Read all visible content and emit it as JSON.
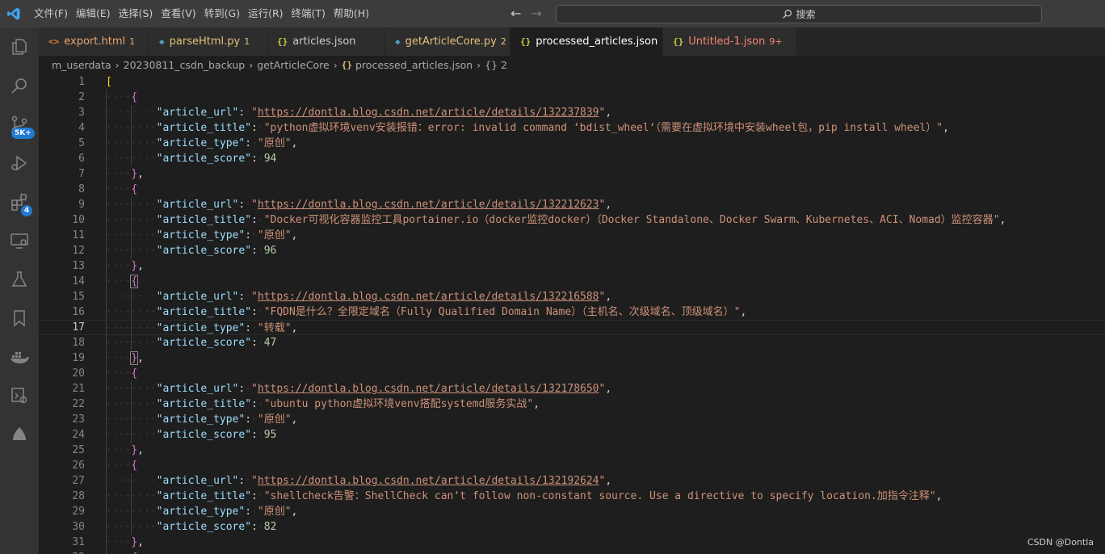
{
  "titlebar": {
    "menus": [
      "文件(F)",
      "编辑(E)",
      "选择(S)",
      "查看(V)",
      "转到(G)",
      "运行(R)",
      "终端(T)",
      "帮助(H)"
    ],
    "search_placeholder": "搜索"
  },
  "activitybar": {
    "scm_badge": "5K+",
    "extensions_badge": "4"
  },
  "tabs": [
    {
      "icon": "<>",
      "label": "export.html",
      "badge": "1",
      "color": "#e8a56b",
      "icon_color": "#e37933"
    },
    {
      "icon": "py",
      "label": "parseHtml.py",
      "badge": "1",
      "color": "#e5c07b",
      "icon_color": "#519aba"
    },
    {
      "icon": "{}",
      "label": "articles.json",
      "badge": "",
      "color": "#cccccc",
      "icon_color": "#cbcb41"
    },
    {
      "icon": "py",
      "label": "getArticleCore.py",
      "badge": "2",
      "color": "#e5c07b",
      "icon_color": "#519aba"
    },
    {
      "icon": "{}",
      "label": "processed_articles.json",
      "badge": "",
      "color": "#ffffff",
      "icon_color": "#cbcb41",
      "active": true
    },
    {
      "icon": "{}",
      "label": "Untitled-1.json",
      "badge": "9+",
      "color": "#f48771",
      "icon_color": "#cbcb41"
    }
  ],
  "breadcrumb": {
    "parts": [
      "m_userdata",
      "20230811_csdn_backup",
      "getArticleCore"
    ],
    "file_icon": "{}",
    "file": "processed_articles.json",
    "symbol": "{} 2"
  },
  "articles": [
    {
      "url": "https://dontla.blog.csdn.net/article/details/132237839",
      "title": "python虚拟环境venv安装报错：error: invalid command ‘bdist_wheel‘（需要在虚拟环境中安装wheel包，pip install wheel）",
      "type": "原创",
      "score": "94"
    },
    {
      "url": "https://dontla.blog.csdn.net/article/details/132212623",
      "title": "Docker可视化容器监控工具portainer.io（docker监控docker）（Docker Standalone、Docker Swarm、Kubernetes、ACI、Nomad）监控容器",
      "type": "原创",
      "score": "96"
    },
    {
      "url": "https://dontla.blog.csdn.net/article/details/132216588",
      "title": "FQDN是什么？全限定域名（Fully Qualified Domain Name）（主机名、次级域名、顶级域名）",
      "type": "转载",
      "score": "47"
    },
    {
      "url": "https://dontla.blog.csdn.net/article/details/132178650",
      "title": "ubuntu python虚拟环境venv搭配systemd服务实战",
      "type": "原创",
      "score": "95"
    },
    {
      "url": "https://dontla.blog.csdn.net/article/details/132192624",
      "title": "shellcheck告警：ShellCheck can‘t follow non-constant source. Use a directive to specify location.加指令注释",
      "type": "原创",
      "score": "82"
    }
  ],
  "keys": {
    "url": "\"article_url\"",
    "title": "\"article_title\"",
    "type": "\"article_type\"",
    "score": "\"article_score\""
  },
  "editor": {
    "current_line": 17,
    "line_count": 32
  },
  "watermark": "CSDN @Dontla"
}
